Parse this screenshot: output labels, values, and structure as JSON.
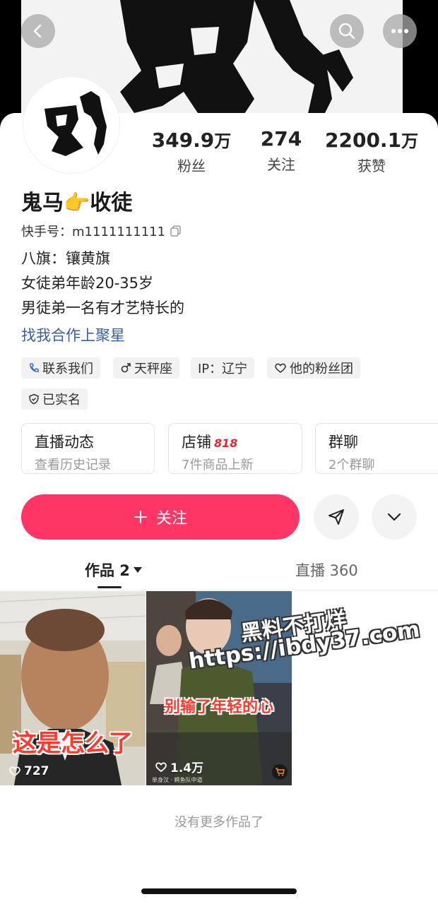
{
  "header": {
    "back_icon": "chevron-left-icon",
    "search_icon": "search-icon",
    "more_icon": "more-horizontal-icon"
  },
  "profile": {
    "name": "鬼马👉收徒",
    "account_id": "快手号：m1111111111",
    "bio_lines": [
      "八旗：镶黄旗",
      "女徒弟年龄20-35岁",
      "男徒弟一名有才艺特长的"
    ],
    "link_text": "找我合作上聚星"
  },
  "stats": [
    {
      "number": "349.9",
      "unit": "万",
      "label": "粉丝"
    },
    {
      "number": "274",
      "unit": "",
      "label": "关注"
    },
    {
      "number": "2200.1",
      "unit": "万",
      "label": "获赞"
    }
  ],
  "tags": [
    {
      "icon": "phone-icon",
      "label": "联系我们"
    },
    {
      "icon": "male-icon",
      "label": "天秤座"
    },
    {
      "icon": "",
      "label": "IP：辽宁"
    },
    {
      "icon": "heart-outline-icon",
      "label": "他的粉丝团"
    },
    {
      "icon": "verified-shield-icon",
      "label": "已实名"
    }
  ],
  "entries": [
    {
      "title": "直播动态",
      "badge": "",
      "subtitle": "查看历史记录"
    },
    {
      "title": "店铺",
      "badge": "818",
      "subtitle": "7件商品上新"
    },
    {
      "title": "群聊",
      "badge": "",
      "subtitle": "2个群聊"
    }
  ],
  "actions": {
    "follow_label": "关注",
    "follow_icon": "plus-icon",
    "share_icon": "send-icon",
    "expand_icon": "chevron-down-icon"
  },
  "tabs": [
    {
      "label": "作品 2",
      "active": true
    },
    {
      "label": "直播 360",
      "active": false
    }
  ],
  "videos": [
    {
      "caption": "这是怎么了",
      "likes": "727"
    },
    {
      "caption": "别输了年轻的心",
      "likes": "1.4万",
      "small_text": "单身汉 · 鳄鱼队中道"
    }
  ],
  "watermark": {
    "line1": "黑料不打烊",
    "line2": "https://ibdy37.com"
  },
  "footer_text": "没有更多作品了",
  "colors": {
    "follow_button": "#fe3666",
    "link": "#385f9e",
    "caption_red": "#ff3b2f"
  }
}
